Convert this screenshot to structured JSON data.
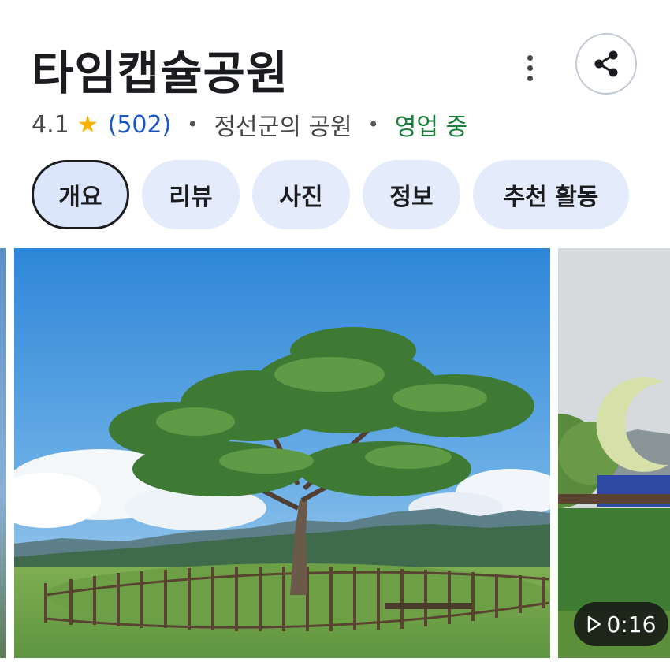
{
  "place": {
    "title": "타임캡슐공원",
    "rating": "4.1",
    "review_count": "(502)",
    "category": "정선군의 공원",
    "status": "영업 중",
    "separator": "•"
  },
  "actions": {
    "more_icon": "more-vert-icon",
    "share_icon": "share-icon"
  },
  "tabs": [
    {
      "label": "개요",
      "active": true
    },
    {
      "label": "리뷰",
      "active": false
    },
    {
      "label": "사진",
      "active": false
    },
    {
      "label": "정보",
      "active": false
    },
    {
      "label": "추천 활동",
      "active": false
    }
  ],
  "media": {
    "video_duration": "0:16"
  },
  "colors": {
    "accent_link": "#1a56c9",
    "open_status": "#188038",
    "star": "#f6b400",
    "chip_bg": "#e4ebfb"
  }
}
